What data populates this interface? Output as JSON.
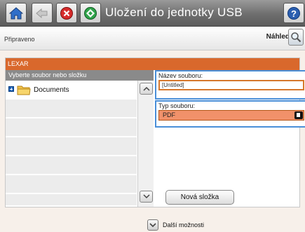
{
  "header": {
    "title": "Uložení do jednotky USB",
    "icons": [
      "home-icon",
      "back-icon",
      "stop-icon",
      "start-icon",
      "help-icon"
    ]
  },
  "status": {
    "text": "Připraveno",
    "preview_label": "Náhled"
  },
  "device": {
    "name": "LEXAR"
  },
  "file_list": {
    "header": "Vyberte soubor nebo složku",
    "items": [
      {
        "label": "Documents",
        "icon": "folder-icon"
      }
    ]
  },
  "file_name": {
    "label": "Název souboru:",
    "value": "[Untitled]"
  },
  "file_type": {
    "label": "Typ souboru:",
    "value": "PDF"
  },
  "actions": {
    "new_folder": "Nová složka",
    "more_options": "Další možnosti"
  },
  "colors": {
    "accent": "#d9682c",
    "selection": "#4a8fd8"
  }
}
